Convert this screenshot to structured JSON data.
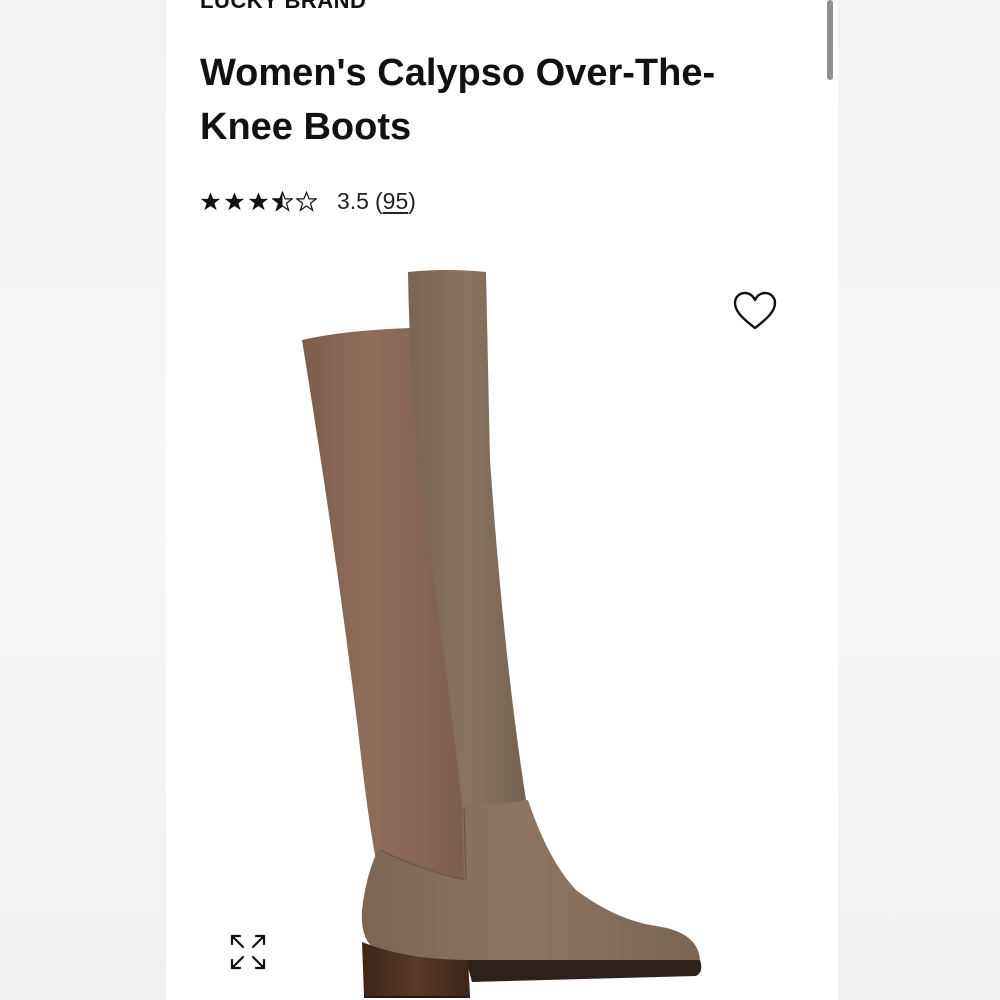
{
  "product": {
    "brand": "LUCKY BRAND",
    "title": "Women's Calypso Over-The-Knee Boots",
    "rating": {
      "stars": 3.5,
      "value_label": "3.5",
      "review_count": "95",
      "open_paren": "(",
      "close_paren": ")"
    },
    "image": {
      "description_name": "boot-image",
      "colors": {
        "suede_shaft": "#8a6a58",
        "suede_lower": "#83715f",
        "heel": "#4a2e1f",
        "sole": "#2d221b"
      }
    }
  },
  "icons": {
    "wishlist": "heart-icon",
    "expand": "expand-icon",
    "star_full": "star-full-icon",
    "star_half": "star-half-icon",
    "star_empty": "star-empty-icon"
  },
  "colors": {
    "text": "#111111",
    "background": "#ffffff",
    "page_background": "#f4f4f4"
  }
}
